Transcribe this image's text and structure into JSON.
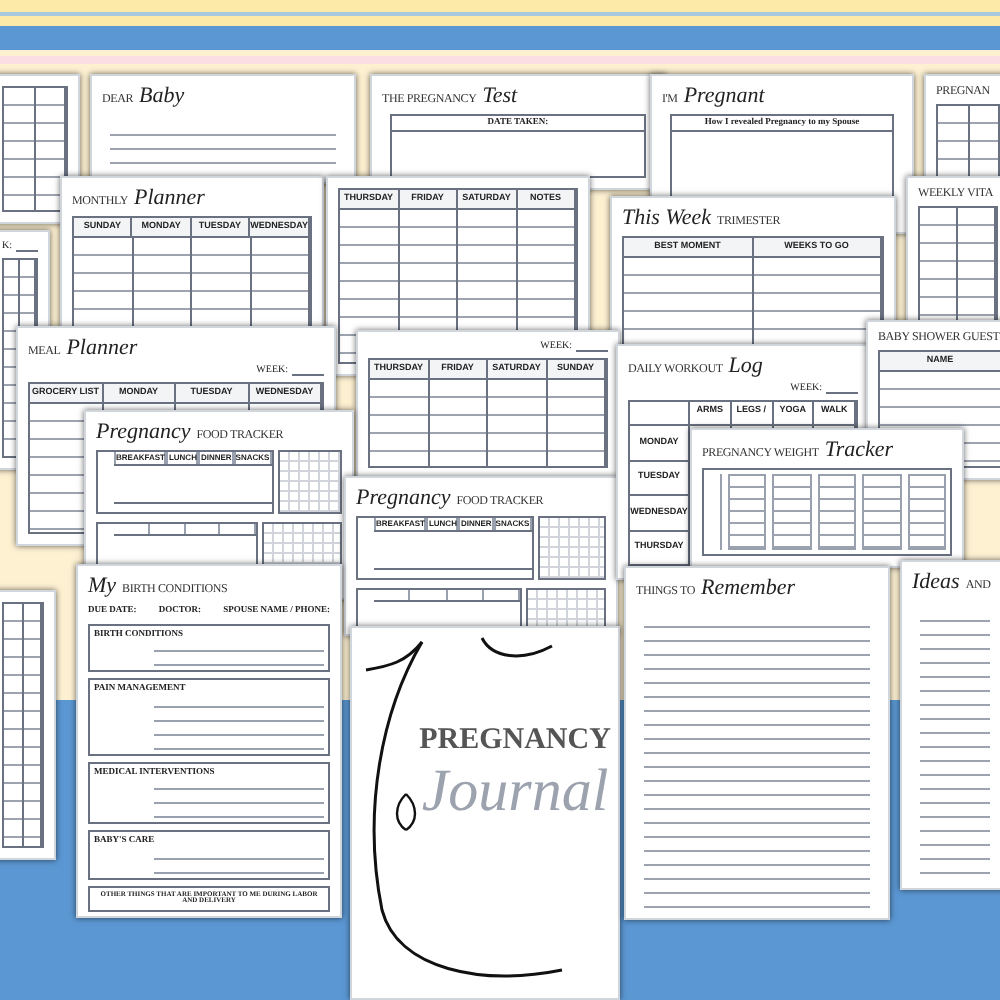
{
  "pages": [
    {
      "kind": "table"
    },
    {
      "kind": "lined",
      "title": [
        {
          "text": "DEAR",
          "kind": "caps"
        },
        {
          "text": "Baby",
          "kind": "script"
        }
      ]
    },
    {
      "kind": "box",
      "title": [
        {
          "text": "THE PREGNANCY",
          "kind": "caps"
        },
        {
          "text": "Test",
          "kind": "script"
        }
      ],
      "box_label": "DATE TAKEN:"
    },
    {
      "kind": "box",
      "title": [
        {
          "text": "I'M",
          "kind": "caps"
        },
        {
          "text": "Pregnant",
          "kind": "script"
        }
      ],
      "box_label": "How I revealed Pregnancy to my Spouse"
    },
    {
      "kind": "table",
      "title": [
        {
          "text": "PREGNAN",
          "kind": "caps"
        }
      ]
    },
    {
      "kind": "table",
      "title": [
        {
          "text": "MONTHLY",
          "kind": "caps"
        },
        {
          "text": "Planner",
          "kind": "script"
        }
      ],
      "columns": [
        "SUNDAY",
        "MONDAY",
        "TUESDAY",
        "WEDNESDAY"
      ]
    },
    {
      "kind": "table",
      "columns": [
        "THURSDAY",
        "FRIDAY",
        "SATURDAY",
        "NOTES"
      ]
    },
    {
      "kind": "table",
      "title": [
        {
          "text": "This Week",
          "kind": "script"
        },
        {
          "text": "TRIMESTER",
          "kind": "caps"
        }
      ],
      "columns": [
        "BEST MOMENT",
        "WEEKS TO GO"
      ]
    },
    {
      "kind": "table",
      "title": [
        {
          "text": "WEEKLY VITA",
          "kind": "caps"
        }
      ]
    },
    {
      "kind": "table",
      "week_label": "K:"
    },
    {
      "kind": "table",
      "title": [
        {
          "text": "MEAL",
          "kind": "caps"
        },
        {
          "text": "Planner",
          "kind": "script"
        }
      ],
      "week_label": "WEEK:",
      "columns": [
        "GROCERY LIST",
        "MONDAY",
        "TUESDAY",
        "WEDNESDAY"
      ]
    },
    {
      "kind": "table",
      "week_label": "WEEK:",
      "columns": [
        "THURSDAY",
        "FRIDAY",
        "SATURDAY",
        "SUNDAY"
      ]
    },
    {
      "kind": "tracker",
      "title": [
        {
          "text": "Pregnancy",
          "kind": "script"
        },
        {
          "text": "FOOD TRACKER",
          "kind": "caps"
        }
      ],
      "columns": [
        "BREAKFAST",
        "LUNCH",
        "DINNER",
        "SNACKS"
      ]
    },
    {
      "kind": "tracker",
      "title": [
        {
          "text": "Pregnancy",
          "kind": "script"
        },
        {
          "text": "FOOD TRACKER",
          "kind": "caps"
        }
      ],
      "columns": [
        "BREAKFAST",
        "LUNCH",
        "DINNER",
        "SNACKS"
      ]
    },
    {
      "kind": "table",
      "title": [
        {
          "text": "DAILY WORKOUT",
          "kind": "caps"
        },
        {
          "text": "Log",
          "kind": "script"
        }
      ],
      "week_label": "WEEK:",
      "columns": [
        "ARMS",
        "LEGS /",
        "YOGA",
        "WALK"
      ],
      "row_labels": [
        "MONDAY",
        "TUESDAY",
        "WEDNESDAY",
        "THURSDAY"
      ]
    },
    {
      "kind": "table",
      "title": [
        {
          "text": "BABY SHOWER GUEST",
          "kind": "caps"
        }
      ],
      "columns": [
        "NAME"
      ]
    },
    {
      "kind": "weight",
      "title": [
        {
          "text": "PREGNANCY WEIGHT",
          "kind": "caps"
        },
        {
          "text": "Tracker",
          "kind": "script"
        }
      ]
    },
    {
      "kind": "form",
      "title": [
        {
          "text": "My",
          "kind": "script"
        },
        {
          "text": "BIRTH CONDITIONS",
          "kind": "caps"
        }
      ],
      "fields": [
        "DUE DATE:",
        "DOCTOR:",
        "SPOUSE NAME / PHONE:"
      ],
      "sections": [
        {
          "heading": "BIRTH CONDITIONS"
        },
        {
          "heading": "PAIN MANAGEMENT"
        },
        {
          "heading": "MEDICAL INTERVENTIONS"
        },
        {
          "heading": "BABY'S CARE"
        }
      ],
      "footer": "OTHER THINGS THAT ARE IMPORTANT TO ME DURING LABOR AND DELIVERY"
    },
    {
      "kind": "cover",
      "title": [
        {
          "text": "PREGNANCY",
          "kind": "caps"
        },
        {
          "text": "Journal",
          "kind": "script"
        }
      ]
    },
    {
      "kind": "lined",
      "title": [
        {
          "text": "THINGS TO",
          "kind": "caps"
        },
        {
          "text": "Remember",
          "kind": "script"
        }
      ]
    },
    {
      "kind": "lined",
      "title": [
        {
          "text": "Ideas",
          "kind": "script"
        },
        {
          "text": "AND",
          "kind": "caps"
        }
      ]
    },
    {
      "kind": "table"
    }
  ]
}
